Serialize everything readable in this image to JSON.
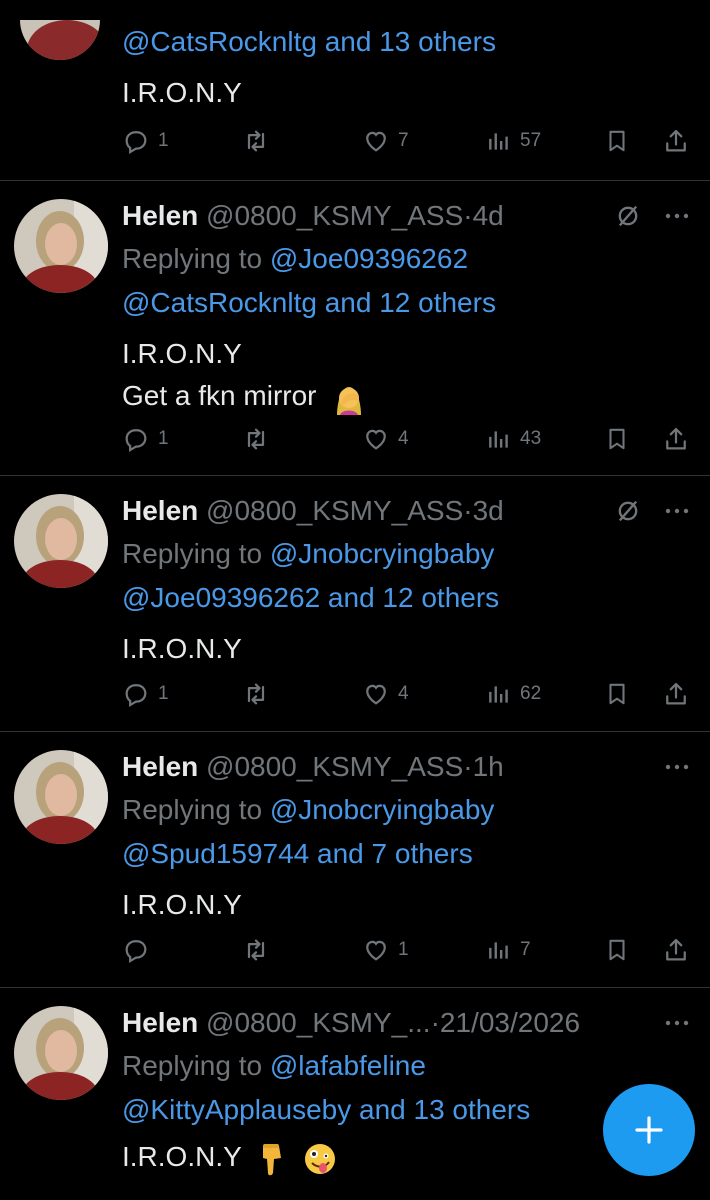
{
  "tweets": [
    {
      "reply_handles": "",
      "reply_rest": "@CatsRocknltg and 13 others",
      "text_line1": "I.R.O.N.Y",
      "replies": "1",
      "reposts": "",
      "likes": "7",
      "views": "57"
    },
    {
      "name": "Helen",
      "handle": "@0800_KSMY_ASS",
      "time": "·4d",
      "replying_label": "Replying to ",
      "replying_to": "@Joe09396262",
      "reply_handle2": "@CatsRocknltg",
      "reply_rest": " and 12 others",
      "text_line1": "I.R.O.N.Y",
      "text_line2": "Get a fkn mirror",
      "replies": "1",
      "reposts": "",
      "likes": "4",
      "views": "43"
    },
    {
      "name": "Helen",
      "handle": "@0800_KSMY_ASS",
      "time": "·3d",
      "replying_label": "Replying to ",
      "replying_to": "@Jnobcryingbaby",
      "reply_handle2": "@Joe09396262",
      "reply_rest": " and 12 others",
      "text_line1": "I.R.O.N.Y",
      "replies": "1",
      "reposts": "",
      "likes": "4",
      "views": "62"
    },
    {
      "name": "Helen",
      "handle": "@0800_KSMY_ASS",
      "time": "·1h",
      "replying_label": "Replying to ",
      "replying_to": "@Jnobcryingbaby",
      "reply_handle2": "@Spud159744",
      "reply_rest": " and 7 others",
      "text_line1": "I.R.O.N.Y",
      "replies": "",
      "reposts": "",
      "likes": "1",
      "views": "7"
    },
    {
      "name": "Helen",
      "handle": "@0800_KSMY_...",
      "time": "·21/03/2026",
      "replying_label": "Replying to ",
      "replying_to": "@lafabfeline",
      "reply_handle2": "@KittyApplauseby",
      "reply_rest": " and 13 others",
      "text_line1": "I.R.O.N.Y"
    }
  ],
  "colors": {
    "background": "#000000",
    "link": "#4a99e9",
    "muted": "#71767b",
    "text": "#e7e9ea",
    "fab": "#1d9bf0",
    "divider": "#2f3336"
  },
  "icons": [
    "reply-icon",
    "repost-icon",
    "like-icon",
    "views-icon",
    "bookmark-icon",
    "share-icon",
    "more-icon",
    "grok-icon",
    "compose-plus-icon",
    "facepalm-emoji",
    "point-down-emoji",
    "zany-face-emoji"
  ]
}
